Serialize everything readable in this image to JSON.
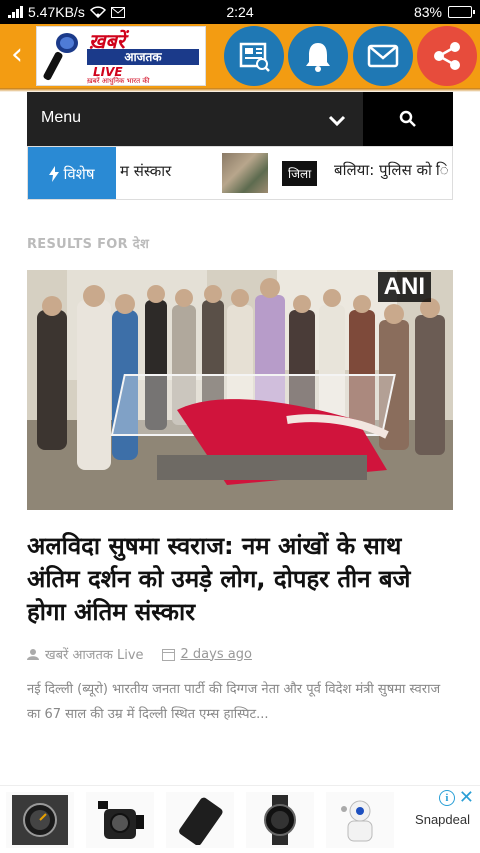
{
  "status_bar": {
    "network_speed": "5.47KB/s",
    "time": "2:24",
    "battery_percent": "83%",
    "battery_level": 0.83
  },
  "header": {
    "logo": {
      "line1": "ख़बरें",
      "line2": "आजतक",
      "line3": "LIVE",
      "tagline": "ख़बरें आधुनिक भारत की"
    },
    "icons": [
      "newspaper-icon",
      "bell-icon",
      "mail-icon",
      "share-icon"
    ],
    "colors": {
      "header_bg": "#f39c12",
      "icon_blue": "#1f78b4",
      "share_red": "#e74c3c"
    }
  },
  "menu": {
    "label": "Menu"
  },
  "ticker": {
    "label": "विशेष",
    "item1": "म संस्कार",
    "badge": "जिला",
    "item2": "बलिया: पुलिस को ि"
  },
  "results": {
    "heading": "RESULTS FOR देश"
  },
  "article": {
    "image_badge": "ANI",
    "title": "अलविदा सुषमा स्वराज: नम आंखों के साथ अंतिम दर्शन को उमड़े लोग, दोपहर तीन बजे होगा अंतिम संस्कार",
    "author": "खबरें आजतक Live",
    "date": "2 days ago",
    "excerpt": "नई दिल्ली (ब्यूरो) भारतीय जनता पार्टी की दिग्गज नेता और पूर्व विदेश मंत्री सुषमा स्वराज का 67 साल की उम्र में दिल्ली स्थित एम्स हास्पिट..."
  },
  "ad": {
    "brand": "Snapdeal",
    "info_label": "i",
    "close_label": "✕",
    "items": [
      "watch-icon",
      "action-camera-icon",
      "phone-case-icon",
      "sports-watch-icon",
      "robot-camera-icon"
    ]
  }
}
